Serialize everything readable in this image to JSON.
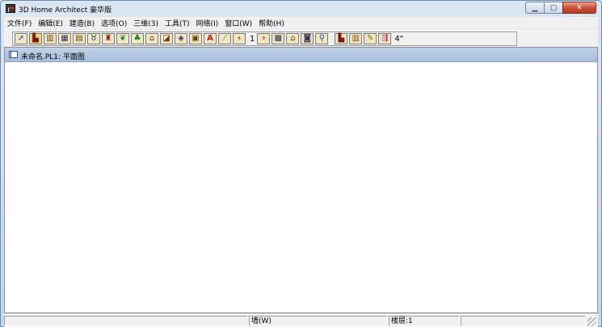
{
  "window": {
    "title": "3D Home Architect 豪华版",
    "app_icon": "house-icon",
    "controls": [
      "minimize-icon",
      "maximize-icon",
      "close-icon"
    ]
  },
  "menubar": {
    "items": [
      {
        "label": "文件(F)"
      },
      {
        "label": "编辑(E)"
      },
      {
        "label": "建造(B)"
      },
      {
        "label": "选项(O)"
      },
      {
        "label": "三维(3)"
      },
      {
        "label": "工具(T)"
      },
      {
        "label": "网络(I)"
      },
      {
        "label": "窗口(W)"
      },
      {
        "label": "帮助(H)"
      }
    ]
  },
  "toolbar": {
    "floor_number": "1",
    "wall_thickness": "4\"",
    "tools": [
      "select-arrow-icon",
      "wall-icon",
      "door-icon",
      "window-icon",
      "cabinet-icon",
      "fixture-icon",
      "furniture-icon",
      "landscape-icon",
      "tree-icon",
      "roof-icon",
      "stairs-icon",
      "dimension-icon",
      "symbol-icon",
      "text-icon",
      "measure-icon",
      "floor-down-icon",
      "floor-up-icon",
      "plan-view-icon",
      "elevation-icon",
      "camera-icon",
      "zoom-icon",
      "draw-walls-icon",
      "railing-icon",
      "pencil-icon",
      "thickness-icon"
    ]
  },
  "document": {
    "title": "未命名.PL1: 平面图",
    "icon": "plan-document-icon"
  },
  "statusbar": {
    "mode": "墙(W)",
    "floor": "楼层:1",
    "grip": "resize-grip-icon"
  },
  "colors": {
    "title_bar": "#cfdceb",
    "close_button": "#c74c32",
    "tool_button": "#efe7c4",
    "active_tool": "#e9d780",
    "child_title": "#b3c7e2",
    "canvas": "#ffffff"
  }
}
